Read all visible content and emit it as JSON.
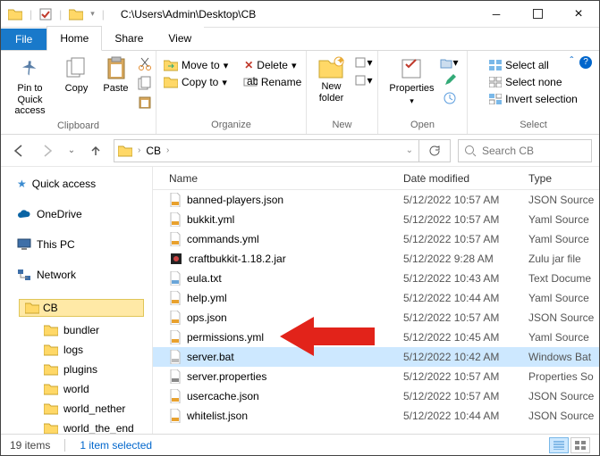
{
  "title_path": "C:\\Users\\Admin\\Desktop\\CB",
  "tabs": {
    "file": "File",
    "home": "Home",
    "share": "Share",
    "view": "View"
  },
  "ribbon": {
    "pin": "Pin to Quick\naccess",
    "copy": "Copy",
    "paste": "Paste",
    "moveto": "Move to",
    "copyto": "Copy to",
    "delete": "Delete",
    "rename": "Rename",
    "newfolder": "New\nfolder",
    "properties": "Properties",
    "selectall": "Select all",
    "selectnone": "Select none",
    "invert": "Invert selection",
    "g_clipboard": "Clipboard",
    "g_organize": "Organize",
    "g_new": "New",
    "g_open": "Open",
    "g_select": "Select"
  },
  "breadcrumb": {
    "folder": "CB"
  },
  "search_placeholder": "Search CB",
  "sidebar": {
    "quick": "Quick access",
    "onedrive": "OneDrive",
    "thispc": "This PC",
    "network": "Network",
    "cb": "CB",
    "bundler": "bundler",
    "logs": "logs",
    "plugins": "plugins",
    "world": "world",
    "world_nether": "world_nether",
    "world_end": "world_the_end"
  },
  "columns": {
    "name": "Name",
    "date": "Date modified",
    "type": "Type"
  },
  "files": [
    {
      "name": "banned-players.json",
      "date": "5/12/2022 10:57 AM",
      "type": "JSON Source",
      "icon": "json"
    },
    {
      "name": "bukkit.yml",
      "date": "5/12/2022 10:57 AM",
      "type": "Yaml Source",
      "icon": "yml"
    },
    {
      "name": "commands.yml",
      "date": "5/12/2022 10:57 AM",
      "type": "Yaml Source",
      "icon": "yml"
    },
    {
      "name": "craftbukkit-1.18.2.jar",
      "date": "5/12/2022 9:28 AM",
      "type": "Zulu jar file",
      "icon": "jar"
    },
    {
      "name": "eula.txt",
      "date": "5/12/2022 10:43 AM",
      "type": "Text Docume",
      "icon": "txt"
    },
    {
      "name": "help.yml",
      "date": "5/12/2022 10:44 AM",
      "type": "Yaml Source",
      "icon": "yml"
    },
    {
      "name": "ops.json",
      "date": "5/12/2022 10:57 AM",
      "type": "JSON Source",
      "icon": "json"
    },
    {
      "name": "permissions.yml",
      "date": "5/12/2022 10:45 AM",
      "type": "Yaml Source",
      "icon": "yml"
    },
    {
      "name": "server.bat",
      "date": "5/12/2022 10:42 AM",
      "type": "Windows Bat",
      "icon": "bat",
      "selected": true
    },
    {
      "name": "server.properties",
      "date": "5/12/2022 10:57 AM",
      "type": "Properties So",
      "icon": "prop"
    },
    {
      "name": "usercache.json",
      "date": "5/12/2022 10:57 AM",
      "type": "JSON Source",
      "icon": "json"
    },
    {
      "name": "whitelist.json",
      "date": "5/12/2022 10:44 AM",
      "type": "JSON Source",
      "icon": "json"
    }
  ],
  "status": {
    "items": "19 items",
    "selected": "1 item selected"
  }
}
